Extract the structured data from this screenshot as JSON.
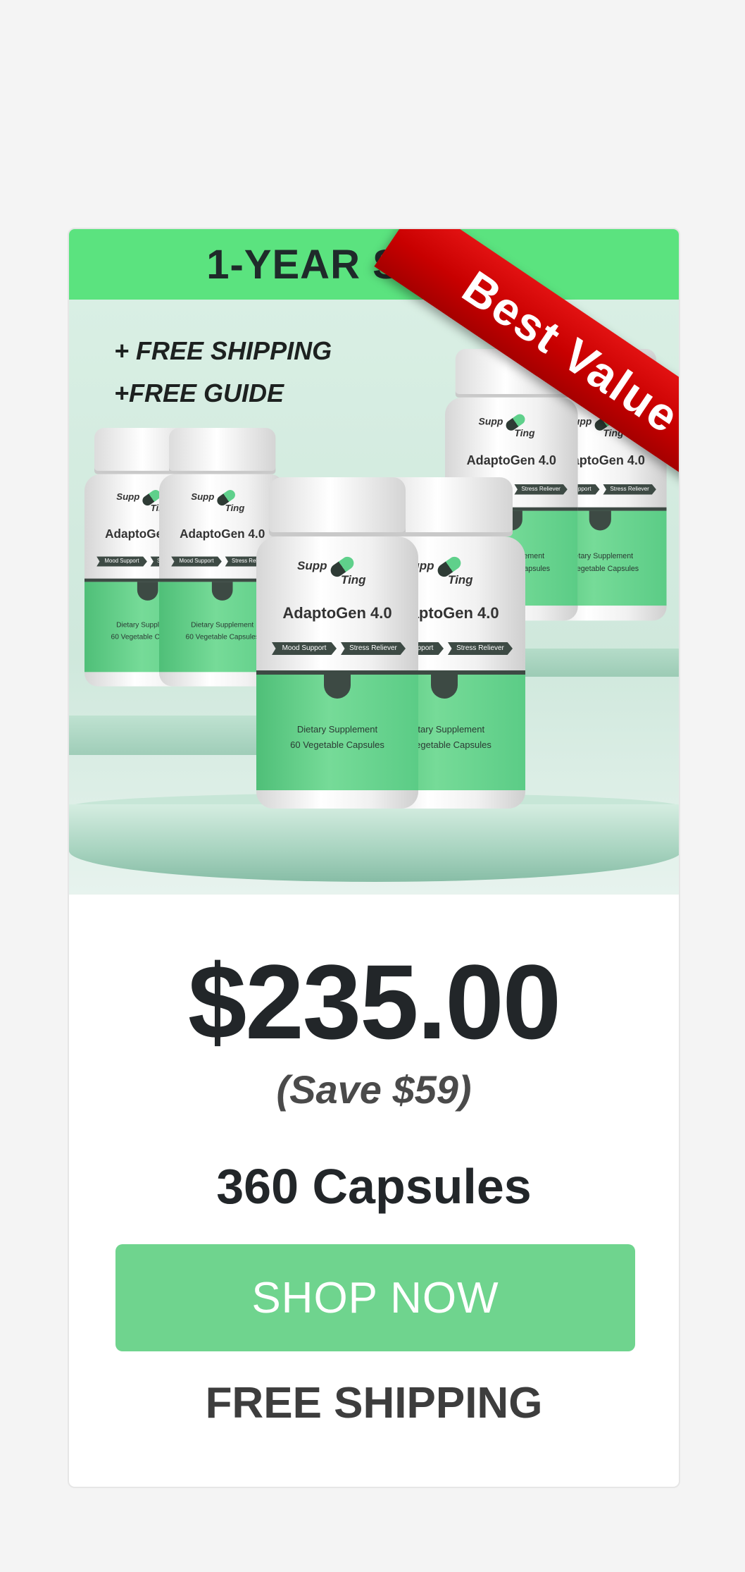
{
  "offer": {
    "plan_title": "1-YEAR S",
    "badge": "Best Value",
    "promo_lines": [
      "+ FREE SHIPPING",
      "+FREE GUIDE"
    ],
    "price": "$235.00",
    "savings": "(Save $59)",
    "quantity": "360 Capsules",
    "cta_label": "SHOP NOW",
    "shipping_note": "FREE SHIPPING"
  },
  "product": {
    "brand_top": "Supp",
    "brand_bottom": "Ting",
    "name": "AdaptoGen 4.0",
    "tag_1": "Mood Support",
    "tag_2": "Stress Reliever",
    "supplement_line": "Dietary Supplement",
    "capsule_line": "60 Vegetable Capsules"
  },
  "colors": {
    "header_green": "#5be37f",
    "button_green": "#6fd48e",
    "ribbon_red": "#c80000",
    "text_dark": "#222629"
  }
}
